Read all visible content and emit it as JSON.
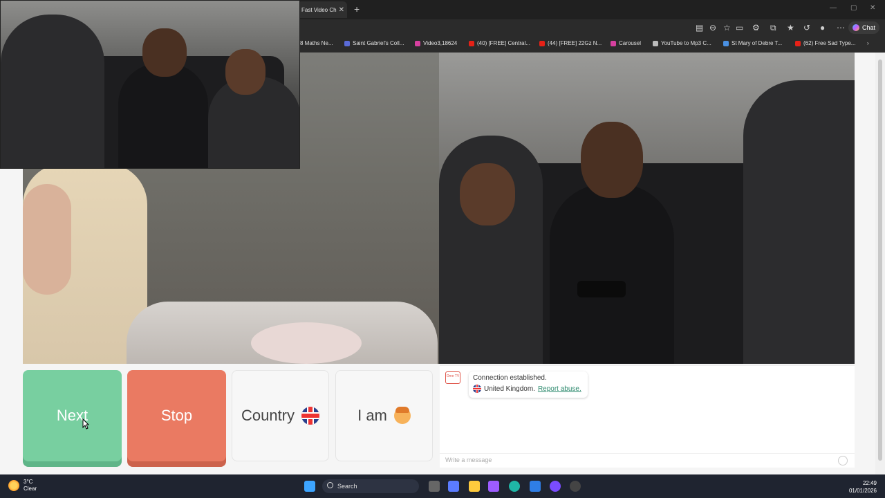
{
  "browser": {
    "active_tab_title": "Fast Video Ch",
    "copilot_label": "Chat",
    "bookmarks": [
      "8 Maths Ne...",
      "Saint Gabriel's Coll...",
      "Video3,18624",
      "(40) [FREE] Central...",
      "(44) [FREE] 22Gz N...",
      "Carousel",
      "YouTube to Mp3 C...",
      "St Mary of Debre T...",
      "(62) Free Sad Type..."
    ]
  },
  "controls": {
    "next_label": "Next",
    "stop_label": "Stop",
    "country_label": "Country",
    "iam_label": "I am"
  },
  "chat": {
    "logo_text": "Ome TV",
    "status_message": "Connection established.",
    "country_text": "United Kingdom.",
    "report_link": "Report abuse.",
    "input_placeholder": "Write a message"
  },
  "taskbar": {
    "temperature": "3°C",
    "weather": "Clear",
    "search_label": "Search",
    "time": "22:49",
    "date": "01/01/2026"
  },
  "colors": {
    "next_button": "#78cfa0",
    "stop_button": "#ea7a62",
    "report_link": "#2d8a6e"
  }
}
